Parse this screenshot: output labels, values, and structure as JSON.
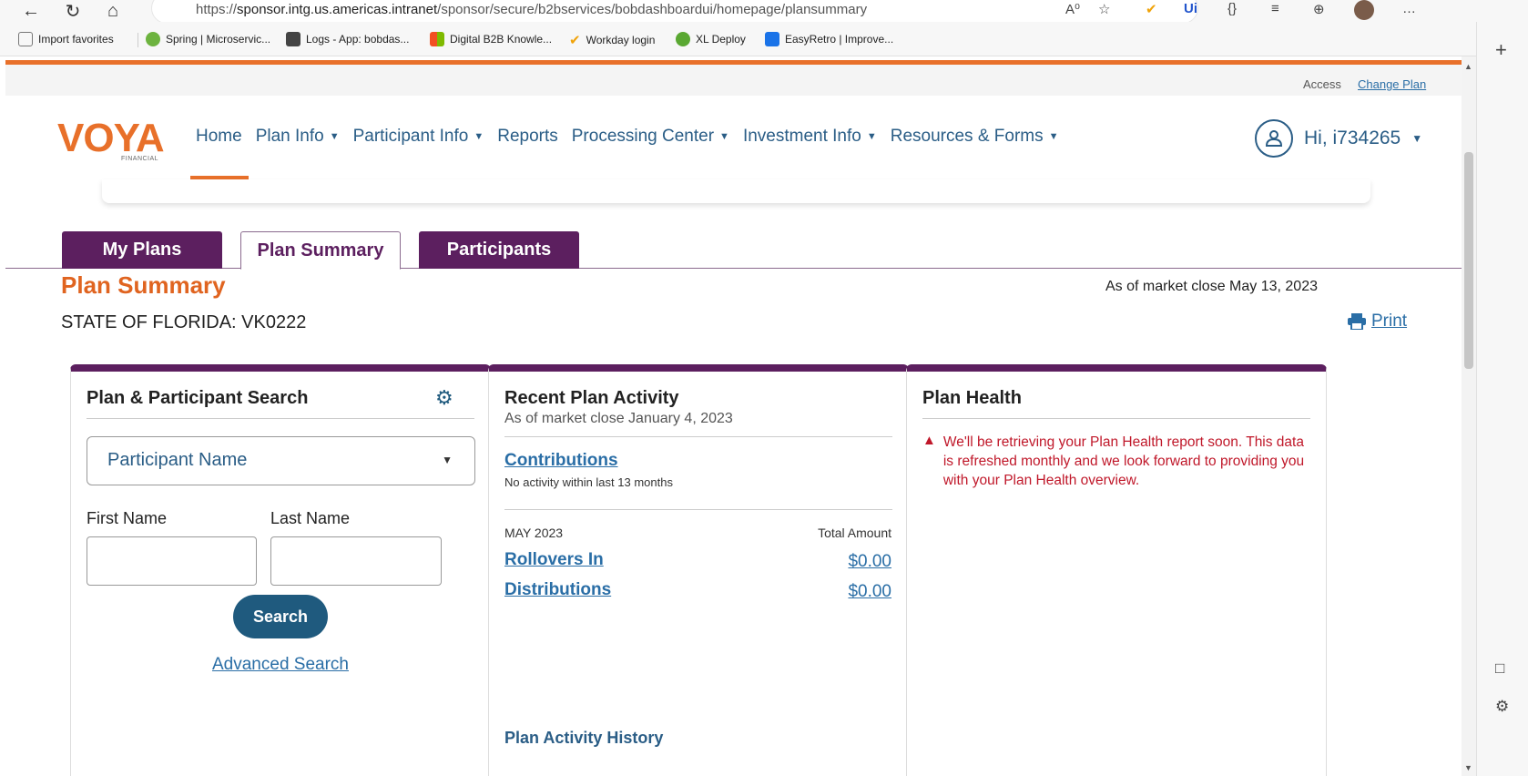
{
  "browser": {
    "url_prefix": "https://",
    "url_host": "sponsor.intg.us.americas.intranet",
    "url_path": "/sponsor/secure/b2bservices/bobdashboardui/homepage/plansummary",
    "back": "←",
    "refresh": "↻",
    "home": "⌂",
    "icons": [
      "A⁰",
      "☆",
      "✔",
      "Ui",
      "{}",
      "≡",
      "⊕",
      "…"
    ],
    "bookmarks": [
      {
        "label": "Import favorites",
        "color": "#777"
      },
      {
        "label": "Spring | Microservic...",
        "color": "#6db33f"
      },
      {
        "label": "Logs - App: bobdas...",
        "color": "#444"
      },
      {
        "label": "Digital B2B Knowle...",
        "color": "#f25022"
      },
      {
        "label": "Workday login",
        "color": "#f0a30a"
      },
      {
        "label": "XL Deploy",
        "color": "#5aa832"
      },
      {
        "label": "EasyRetro | Improve...",
        "color": "#1a73e8"
      }
    ],
    "side_plus": "+",
    "side_icons": [
      "□",
      "⚙"
    ]
  },
  "top": {
    "access": "Access",
    "change_plan": "Change Plan"
  },
  "header": {
    "logo": "VOYA",
    "logo_sub": "FINANCIAL",
    "nav": [
      {
        "label": "Home",
        "caret": ""
      },
      {
        "label": "Plan Info",
        "caret": "▼"
      },
      {
        "label": "Participant Info",
        "caret": "▼"
      },
      {
        "label": "Reports",
        "caret": ""
      },
      {
        "label": "Processing Center",
        "caret": "▼"
      },
      {
        "label": "Investment Info",
        "caret": "▼"
      },
      {
        "label": "Resources & Forms",
        "caret": "▼"
      }
    ],
    "user": "Hi, i734265",
    "user_caret": "▼"
  },
  "tabs": [
    "My Plans",
    "Plan Summary",
    "Participants"
  ],
  "page": {
    "title": "Plan Summary",
    "plan_name": "STATE OF FLORIDA: VK0222",
    "as_of": "As of market close May 13, 2023",
    "print": "Print"
  },
  "search_card": {
    "title": "Plan & Participant Search",
    "select_value": "Participant Name",
    "first_name_label": "First Name",
    "last_name_label": "Last Name",
    "search_button": "Search",
    "advanced_search": "Advanced Search"
  },
  "activity_card": {
    "title": "Recent Plan Activity",
    "as_of": "As of market close January 4, 2023",
    "contributions": "Contributions",
    "no_activity": "No activity within last 13 months",
    "month": "MAY 2023",
    "total_label": "Total Amount",
    "rows": [
      {
        "label": "Rollovers In",
        "amount": "$0.00"
      },
      {
        "label": "Distributions",
        "amount": "$0.00"
      }
    ],
    "history": "Plan Activity History"
  },
  "health_card": {
    "title": "Plan Health",
    "alert": "We'll be retrieving your Plan Health report soon. This data is refreshed monthly and we look forward to providing you with your Plan Health overview."
  }
}
